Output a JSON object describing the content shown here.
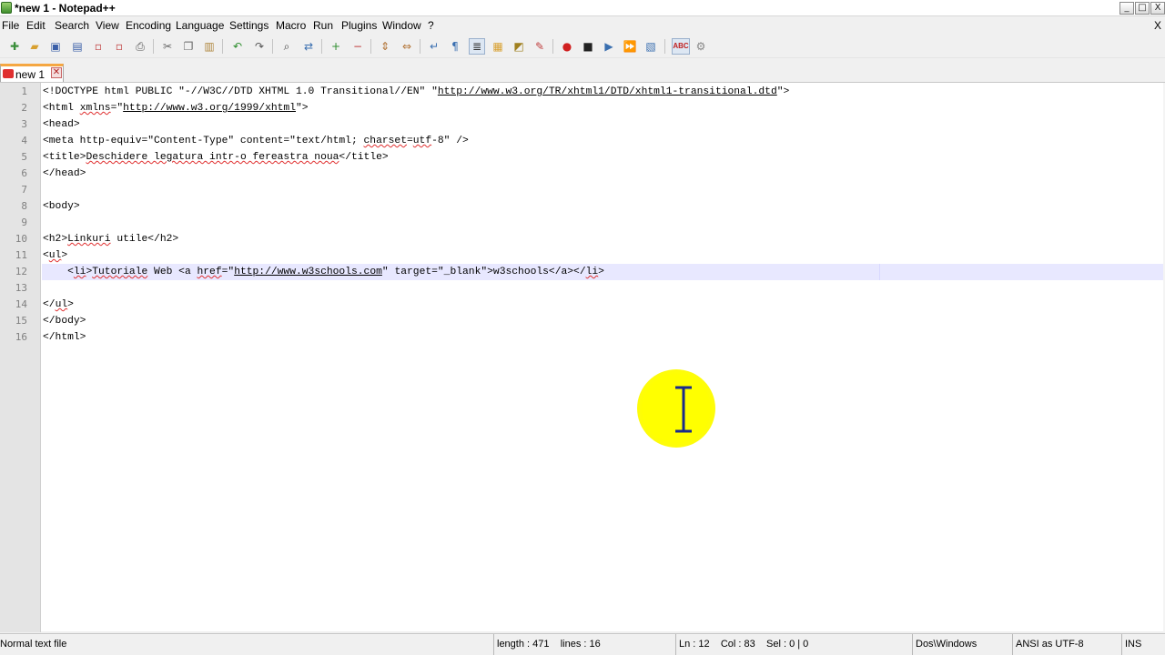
{
  "window": {
    "title": "*new  1 - Notepad++",
    "controls": {
      "minimize": "_",
      "maximize": "□",
      "close": "X"
    }
  },
  "menu": {
    "items": [
      "File",
      "Edit",
      "Search",
      "View",
      "Encoding",
      "Language",
      "Settings",
      "Macro",
      "Run",
      "Plugins",
      "Window",
      "?"
    ],
    "close_document": "X"
  },
  "toolbar": {
    "icons": [
      "new-file-icon",
      "open-file-icon",
      "save-icon",
      "save-all-icon",
      "close-icon",
      "close-all-icon",
      "print-icon",
      "cut-icon",
      "copy-icon",
      "paste-icon",
      "undo-icon",
      "redo-icon",
      "find-icon",
      "replace-icon",
      "zoom-in-icon",
      "zoom-out-icon",
      "sync-vertical-icon",
      "sync-horizontal-icon",
      "word-wrap-icon",
      "show-all-chars-icon",
      "indent-guide-icon",
      "user-language-icon",
      "function-list-icon",
      "document-map-icon",
      "record-macro-icon",
      "stop-recording-icon",
      "playback-macro-icon",
      "run-macro-multiple-icon",
      "save-macro-icon",
      "spellcheck-icon",
      "spellcheck-settings-icon"
    ],
    "spellcheck_label": "ABC"
  },
  "tabs": [
    {
      "label": "new  1",
      "close": "✕",
      "active": true
    }
  ],
  "editor": {
    "current_line": 12,
    "lines": [
      {
        "n": "1",
        "text": "<!DOCTYPE html PUBLIC \"-//W3C//DTD XHTML 1.0 Transitional//EN\" \"",
        "link": "http://www.w3.org/TR/xhtml1/DTD/xhtml1-transitional.dtd",
        "after": "\">"
      },
      {
        "n": "2",
        "text": "<html ",
        "squig": "xmlns",
        "mid": "=\"",
        "link": "http://www.w3.org/1999/xhtml",
        "after": "\">"
      },
      {
        "n": "3",
        "text": "<head>"
      },
      {
        "n": "4",
        "text": "<meta http-equiv=\"Content-Type\" content=\"text/html; ",
        "squig": "charset",
        "mid": "=",
        "squig2": "utf",
        "after": "-8\" />"
      },
      {
        "n": "5",
        "text": "<title>",
        "squig": "Deschidere legatura intr-o fereastra noua",
        "after": "</title>"
      },
      {
        "n": "6",
        "text": "</head>"
      },
      {
        "n": "7",
        "text": ""
      },
      {
        "n": "8",
        "text": "<body>"
      },
      {
        "n": "9",
        "text": ""
      },
      {
        "n": "10",
        "text": "<h2>",
        "squig": "Linkuri",
        "after": " utile</h2>"
      },
      {
        "n": "11",
        "text": "<",
        "squig": "ul",
        "after": ">"
      },
      {
        "n": "12",
        "text": "    <",
        "squig": "li",
        "mid": ">",
        "squig2": "Tutoriale",
        "mid2": " Web <a ",
        "squig3": "href",
        "mid3": "=\"",
        "link": "http://www.w3schools.com",
        "after": "\" target=\"_blank\">w3schools</a></",
        "squig4": "li",
        "after2": ">"
      },
      {
        "n": "13",
        "text": ""
      },
      {
        "n": "14",
        "text": "</",
        "squig": "ul",
        "after": ">"
      },
      {
        "n": "15",
        "text": "</body>"
      },
      {
        "n": "16",
        "text": "</html>"
      }
    ]
  },
  "status": {
    "file_type": "Normal text file",
    "length": "length : 471    lines : 16",
    "position": "Ln : 12    Col : 83    Sel : 0 | 0",
    "eol": "Dos\\Windows",
    "encoding": "ANSI as UTF-8",
    "mode": "INS"
  },
  "colors": {
    "current_line_bg": "#e8e8ff",
    "cursor_highlight": "#ffff00",
    "tab_accent": "#f5a742"
  }
}
